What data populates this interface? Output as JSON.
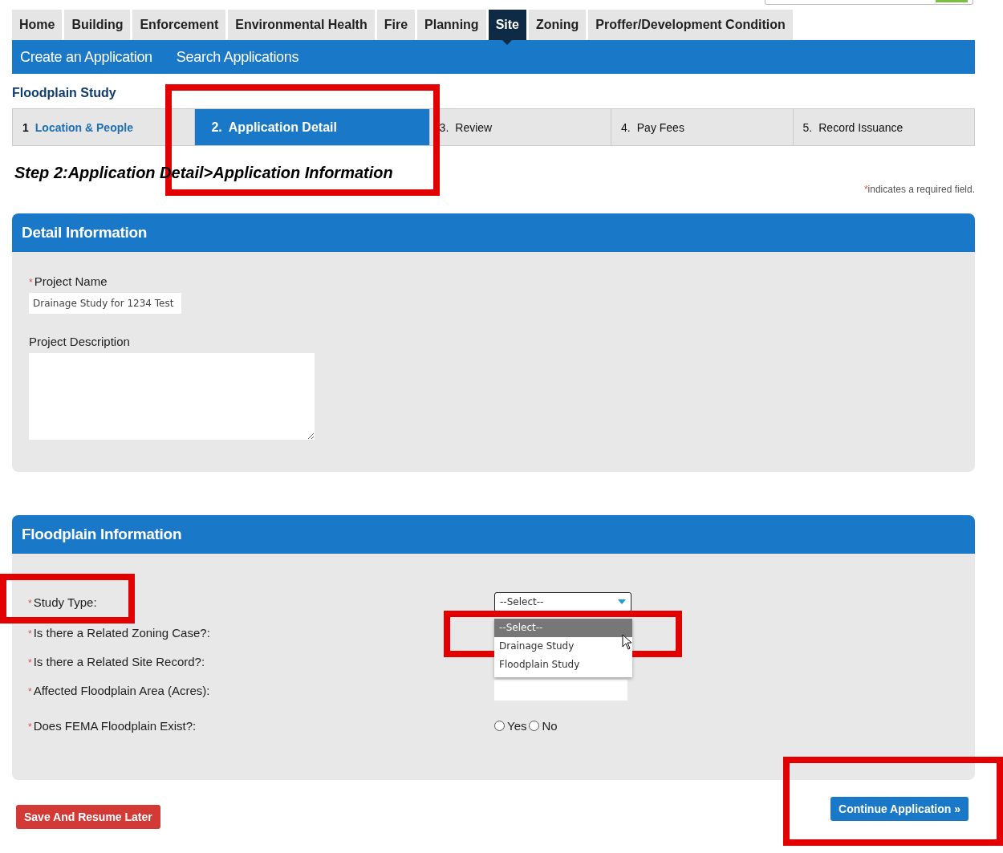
{
  "tabs": [
    {
      "label": "Home",
      "selected": false
    },
    {
      "label": "Building",
      "selected": false
    },
    {
      "label": "Enforcement",
      "selected": false
    },
    {
      "label": "Environmental Health",
      "selected": false
    },
    {
      "label": "Fire",
      "selected": false
    },
    {
      "label": "Planning",
      "selected": false
    },
    {
      "label": "Site",
      "selected": true
    },
    {
      "label": "Zoning",
      "selected": false
    },
    {
      "label": "Proffer/Development Condition",
      "selected": false
    }
  ],
  "subnav": [
    "Create an Application",
    "Search Applications"
  ],
  "record_type": "Floodplain Study",
  "steps": [
    {
      "number": "1",
      "label": "Location & People",
      "kind": "completed"
    },
    {
      "number": "2.",
      "label": "Application Detail",
      "kind": "current",
      "highlighted": true
    },
    {
      "number": "3.",
      "label": "Review",
      "kind": "upcoming"
    },
    {
      "number": "4.",
      "label": "Pay Fees",
      "kind": "upcoming"
    },
    {
      "number": "5.",
      "label": "Record Issuance",
      "kind": "upcoming"
    }
  ],
  "heading": "Step 2:Application Detail>Application Information",
  "required_note": {
    "mark": "*",
    "text": "indicates a required field."
  },
  "sections": [
    {
      "title": "Detail Information",
      "kind": "stacked",
      "fields": [
        {
          "label": "Project Name",
          "required": true,
          "kind": "text",
          "value": "Drainage Study for 1234 Test"
        },
        {
          "label": "Project Description",
          "required": false,
          "kind": "textarea"
        }
      ]
    },
    {
      "title": "Floodplain Information",
      "kind": "inline",
      "fields": [
        {
          "label": "Study Type:",
          "required": true,
          "kind": "select",
          "value": "--Select--",
          "expanded": true,
          "highlighted": true,
          "options_highlighted": true,
          "options": [
            {
              "label": "--Select--",
              "selected": true
            },
            {
              "label": "Drainage Study",
              "selected": false
            },
            {
              "label": "Floodplain Study",
              "selected": false
            }
          ]
        },
        {
          "label": "Is there a Related Zoning Case?:",
          "required": true,
          "kind": "covered"
        },
        {
          "label": "Is there a Related Site Record?:",
          "required": true,
          "kind": "covered"
        },
        {
          "label": "Affected Floodplain Area (Acres):",
          "required": true,
          "kind": "text"
        },
        {
          "label": "Does FEMA Floodplain Exist?:",
          "required": true,
          "kind": "radio",
          "options": [
            {
              "label": "Yes",
              "selected": false
            },
            {
              "label": "No",
              "selected": false
            }
          ]
        }
      ]
    }
  ],
  "buttons": {
    "save": {
      "label": "Save And Resume Later"
    },
    "continue": {
      "label": "Continue Application »",
      "highlighted": true
    }
  }
}
